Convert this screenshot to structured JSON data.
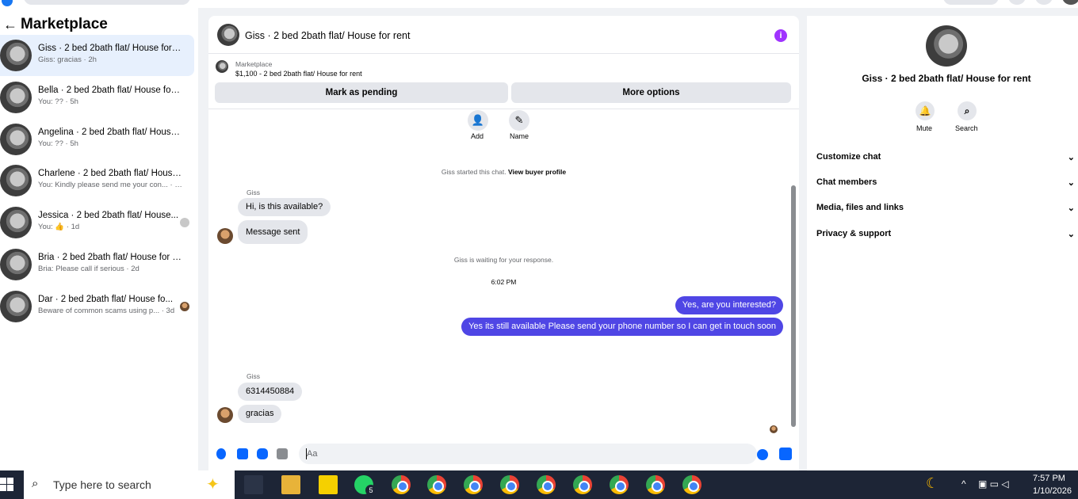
{
  "sidebar": {
    "back_icon": "←",
    "title": "Marketplace",
    "conversations": [
      {
        "title": "Giss · 2 bed 2bath flat/ House for r...",
        "sub": "Giss: gracias · 2h",
        "active": true
      },
      {
        "title": "Bella · 2 bed 2bath flat/ House for ...",
        "sub": "You: ?? · 5h"
      },
      {
        "title": "Angelina · 2 bed 2bath flat/ House...",
        "sub": "You: ?? · 5h"
      },
      {
        "title": "Charlene · 2 bed 2bath flat/ House...",
        "sub": "You: Kindly please send me your con... · 22h"
      },
      {
        "title": "Jessica · 2 bed 2bath flat/ House...",
        "sub": "You: 👍 · 1d"
      },
      {
        "title": "Bria · 2 bed 2bath flat/ House for r...",
        "sub": "Bria: Please call if serious · 2d"
      },
      {
        "title": "Dar · 2 bed 2bath flat/ House fo...",
        "sub": "Beware of common scams using p... · 3d"
      }
    ]
  },
  "chat": {
    "header_title": "Giss · 2 bed 2bath flat/ House for rent",
    "info_icon": "i",
    "marketplace_label": "Marketplace",
    "listing": "$1,100 - 2 bed 2bath flat/ House for rent",
    "mark_pending": "Mark as pending",
    "more_options": "More options",
    "add_label": "Add",
    "name_label": "Name",
    "add_icon": "👤",
    "name_icon": "✎",
    "started_text": "Giss started this chat.",
    "view_profile": "View buyer profile",
    "sender_name": "Giss",
    "msg_in_1": "Hi, is this available?",
    "msg_in_2": "Message sent",
    "waiting_text": "Giss is waiting for your response.",
    "time": "6:02 PM",
    "msg_out_1": "Yes, are you interested?",
    "msg_out_2": "Yes its still available Please send your phone number so I can get in touch soon",
    "sender_name_2": "Giss",
    "msg_in_3": "6314450884",
    "msg_in_4": "gracias",
    "composer_placeholder": "Aa"
  },
  "right_panel": {
    "name": "Giss · 2 bed 2bath flat/ House for rent",
    "mute_label": "Mute",
    "search_label": "Search",
    "mute_icon": "🔔",
    "search_icon": "⌕",
    "sections": [
      "Customize chat",
      "Chat members",
      "Media, files and links",
      "Privacy & support"
    ],
    "chevron": "⌄"
  },
  "taskbar": {
    "search_placeholder": "Type here to search",
    "clock_time": "7:57 PM",
    "clock_date": "1/10/2026",
    "whatsapp_badge": "5"
  },
  "colors": {
    "accent": "#4f46e5",
    "info": "#a033ff",
    "messenger_blue": "#0866ff"
  }
}
